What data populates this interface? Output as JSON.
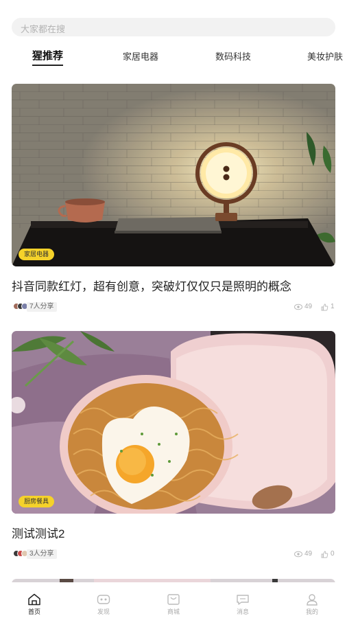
{
  "search": {
    "placeholder": "大家都在搜"
  },
  "tabs": [
    {
      "label": "猩推荐",
      "active": true
    },
    {
      "label": "家居电器",
      "active": false
    },
    {
      "label": "数码科技",
      "active": false
    },
    {
      "label": "美妆护肤",
      "active": false
    }
  ],
  "feed": [
    {
      "tag": "家居电器",
      "title": "抖音同款红灯，超有创意，突破灯仅仅只是照明的概念",
      "share": "7人分享",
      "views": "49",
      "likes": "1",
      "image_icon": "lamp-photo"
    },
    {
      "tag": "厨房餐具",
      "title": "测试测试2",
      "share": "3人分享",
      "views": "49",
      "likes": "0",
      "image_icon": "noodle-bowl-photo"
    }
  ],
  "nav": [
    {
      "label": "首页",
      "icon": "home-icon",
      "active": true
    },
    {
      "label": "发现",
      "icon": "discover-icon",
      "active": false
    },
    {
      "label": "商城",
      "icon": "shop-icon",
      "active": false
    },
    {
      "label": "消息",
      "icon": "message-icon",
      "active": false
    },
    {
      "label": "我的",
      "icon": "profile-icon",
      "active": false
    }
  ],
  "colors": {
    "tag": "#f5d22a",
    "active_text": "#222222",
    "inactive_text": "#aaaaaa"
  }
}
